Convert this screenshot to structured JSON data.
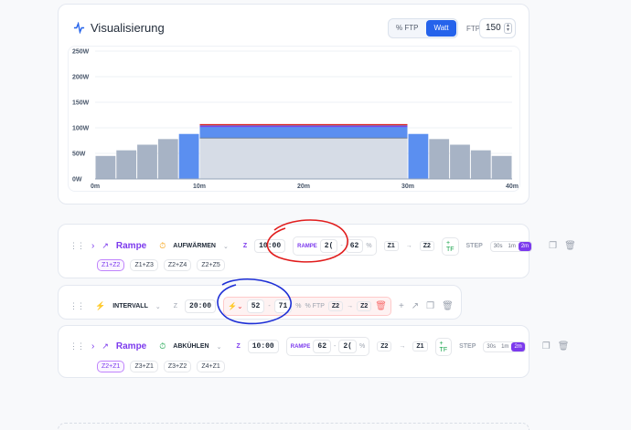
{
  "visualization": {
    "title": "Visualisierung",
    "mode_ftp": "% FTP",
    "mode_watt": "Watt",
    "ftp_label": "FTP",
    "ftp_value": "150"
  },
  "chart_data": {
    "type": "bar",
    "y_ticks": [
      "250W",
      "200W",
      "150W",
      "100W",
      "50W",
      "0W"
    ],
    "x_ticks": [
      "0m",
      "10m",
      "20m",
      "30m",
      "40m"
    ],
    "ylim": [
      0,
      250
    ],
    "xlim": [
      0,
      40
    ],
    "segments": [
      {
        "start": 0,
        "end": 2,
        "value": 45,
        "kind": "warmup"
      },
      {
        "start": 2,
        "end": 4,
        "value": 56,
        "kind": "warmup"
      },
      {
        "start": 4,
        "end": 6,
        "value": 67,
        "kind": "warmup"
      },
      {
        "start": 6,
        "end": 8,
        "value": 78,
        "kind": "warmup"
      },
      {
        "start": 8,
        "end": 10,
        "value": 88,
        "kind": "warmup-highlight"
      },
      {
        "start": 10,
        "end": 30,
        "value": 106,
        "kind": "interval"
      },
      {
        "start": 30,
        "end": 32,
        "value": 88,
        "kind": "cooldown-highlight"
      },
      {
        "start": 32,
        "end": 34,
        "value": 78,
        "kind": "cooldown"
      },
      {
        "start": 34,
        "end": 36,
        "value": 67,
        "kind": "cooldown"
      },
      {
        "start": 36,
        "end": 38,
        "value": 56,
        "kind": "cooldown"
      },
      {
        "start": 38,
        "end": 40,
        "value": 45,
        "kind": "cooldown"
      }
    ],
    "interval_base": 80,
    "colors": {
      "bar": "#a7b3c5",
      "highlight": "#5b8ff0",
      "interval_fill": "#d6dce6",
      "interval_top": "#dc2626",
      "interval_mid": "#7c3aed"
    }
  },
  "blocks": {
    "warmup": {
      "type_label": "Rampe",
      "phase_label": "AUFWÄRMEN",
      "duration": "10:00",
      "ramp_label": "RAMPE",
      "from": "2(",
      "to": "62",
      "unit": "%",
      "zone_from": "Z1",
      "zone_to": "Z2",
      "tf_label": "+ TF",
      "step_label": "STEP",
      "steps": [
        "30s",
        "1m",
        "2m"
      ],
      "zone_pills": [
        "Z1+Z2",
        "Z1+Z3",
        "Z2+Z4",
        "Z2+Z5"
      ]
    },
    "interval": {
      "type_label": "INTERVALL",
      "z_label": "Z",
      "duration": "20:00",
      "from": "52",
      "to": "71",
      "unit": "%",
      "ftp_label": "% FTP",
      "zone_from": "Z2",
      "zone_to": "Z2"
    },
    "cooldown": {
      "type_label": "Rampe",
      "phase_label": "ABKÜHLEN",
      "duration": "10:00",
      "ramp_label": "RAMPE",
      "from": "62",
      "to": "2(",
      "unit": "%",
      "zone_from": "Z2",
      "zone_to": "Z1",
      "tf_label": "+ TF",
      "step_label": "STEP",
      "steps": [
        "30s",
        "1m",
        "2m"
      ],
      "zone_pills": [
        "Z2+Z1",
        "Z3+Z1",
        "Z3+Z2",
        "Z4+Z1"
      ]
    }
  }
}
